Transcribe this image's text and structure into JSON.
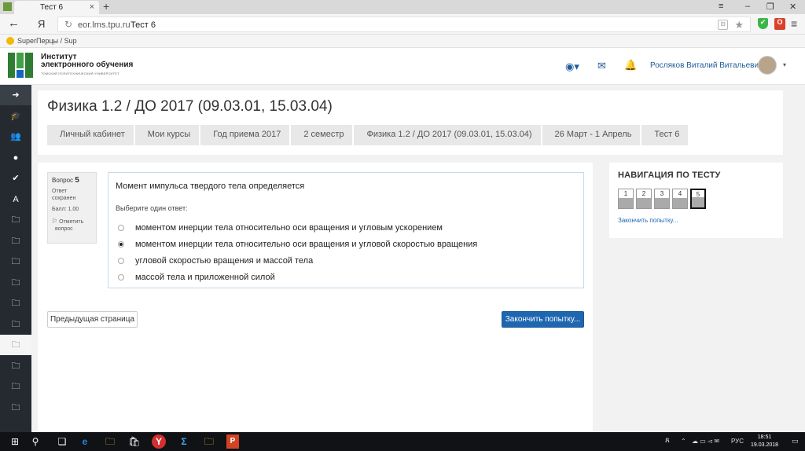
{
  "browser": {
    "tab_title": "Тест 6",
    "tab_close": "×",
    "new_tab": "+",
    "back_icon": "←",
    "yandex_label": "Я",
    "reload_icon": "↻",
    "url": "eor.lms.tpu.ru",
    "page_title": "Тест 6",
    "star_icon": "★",
    "ext_icon": "⊟",
    "menu_icon": "≡",
    "win_min": "–",
    "win_max": "❐",
    "win_close": "✕",
    "win_menu": "≡",
    "bookmark": "SuperПерцы / Sup"
  },
  "site": {
    "logo_line1": "Институт",
    "logo_line2": "электронного обучения",
    "logo_sub": "ТОМСКИЙ ПОЛИТЕХНИЧЕСКИЙ УНИВЕРСИТЕТ",
    "globe_icon": "◉▾",
    "mail_icon": "✉",
    "bell_icon": "🔔",
    "user_name": "Росляков Виталий Витальевич",
    "caret": "▾"
  },
  "dock": [
    {
      "icon": "➜",
      "name": "dock-toggle-icon"
    },
    {
      "icon": "🎓",
      "name": "dock-courses-icon"
    },
    {
      "icon": "👥",
      "name": "dock-users-icon"
    },
    {
      "icon": "●",
      "name": "dock-dot-icon"
    },
    {
      "icon": "✔",
      "name": "dock-check-icon"
    },
    {
      "icon": "A",
      "name": "dock-font-icon"
    },
    {
      "icon": "🗀",
      "name": "dock-folder-icon"
    },
    {
      "icon": "🗀",
      "name": "dock-folder-icon"
    },
    {
      "icon": "🗀",
      "name": "dock-folder-icon"
    },
    {
      "icon": "🗀",
      "name": "dock-folder-icon"
    },
    {
      "icon": "🗀",
      "name": "dock-folder-icon"
    },
    {
      "icon": "🗀",
      "name": "dock-folder-icon"
    },
    {
      "icon": "🗀",
      "name": "dock-folder-icon"
    },
    {
      "icon": "🗀",
      "name": "dock-folder-icon"
    },
    {
      "icon": "🗀",
      "name": "dock-folder-icon"
    },
    {
      "icon": "🗀",
      "name": "dock-folder-icon"
    }
  ],
  "page": {
    "title": "Физика 1.2 / ДО 2017 (09.03.01, 15.03.04)",
    "breadcrumb": [
      "Личный кабинет",
      "Мои курсы",
      "Год приема 2017",
      "2 семестр",
      "Физика 1.2 / ДО 2017 (09.03.01, 15.03.04)",
      "26 Март - 1 Апрель",
      "Тест 6"
    ]
  },
  "question": {
    "label": "Вопрос",
    "number": "5",
    "status_line1": "Ответ",
    "status_line2": "сохранен",
    "grade": "Балл: 1.00",
    "flag_icon": "⚐",
    "flag_line1": "Отметить",
    "flag_line2": "вопрос",
    "text": "Момент импульса твердого тела определяется",
    "prompt": "Выберите один ответ:",
    "answers": [
      {
        "text": "моментом инерции тела относительно оси вращения и угловым ускорением",
        "selected": false
      },
      {
        "text": "моментом инерции тела относительно оси вращения и угловой скоростью вращения",
        "selected": true
      },
      {
        "text": "угловой скоростью вращения и массой тела",
        "selected": false
      },
      {
        "text": "массой тела и приложенной силой",
        "selected": false
      }
    ]
  },
  "buttons": {
    "prev": "Предыдущая страница",
    "finish": "Закончить попытку..."
  },
  "quiz_nav": {
    "title": "НАВИГАЦИЯ ПО ТЕСТУ",
    "items": [
      "1",
      "2",
      "3",
      "4",
      "5"
    ],
    "current": "5",
    "finish_link": "Закончить попытку..."
  },
  "taskbar": {
    "start_icon": "⊞",
    "search_icon": "⚲",
    "tasks_icon": "❏",
    "edge_icon": "e",
    "explorer_icon": "🗀",
    "store_icon": "🛍",
    "yandex_icon": "Y",
    "sum_icon": "Σ",
    "folder2_icon": "🗀",
    "ppt_icon": "P",
    "tray_people": "ጸ",
    "tray_up": "⌃",
    "tray_icons": "☁ ▭ ◅ ✉",
    "lang": "РУС",
    "time": "18:51",
    "date": "19.03.2018",
    "notify_icon": "▭"
  },
  "colors": {
    "accent": "#1f66b0",
    "dock_bg": "#252a30",
    "crumb_bg": "#e8e8e8"
  }
}
